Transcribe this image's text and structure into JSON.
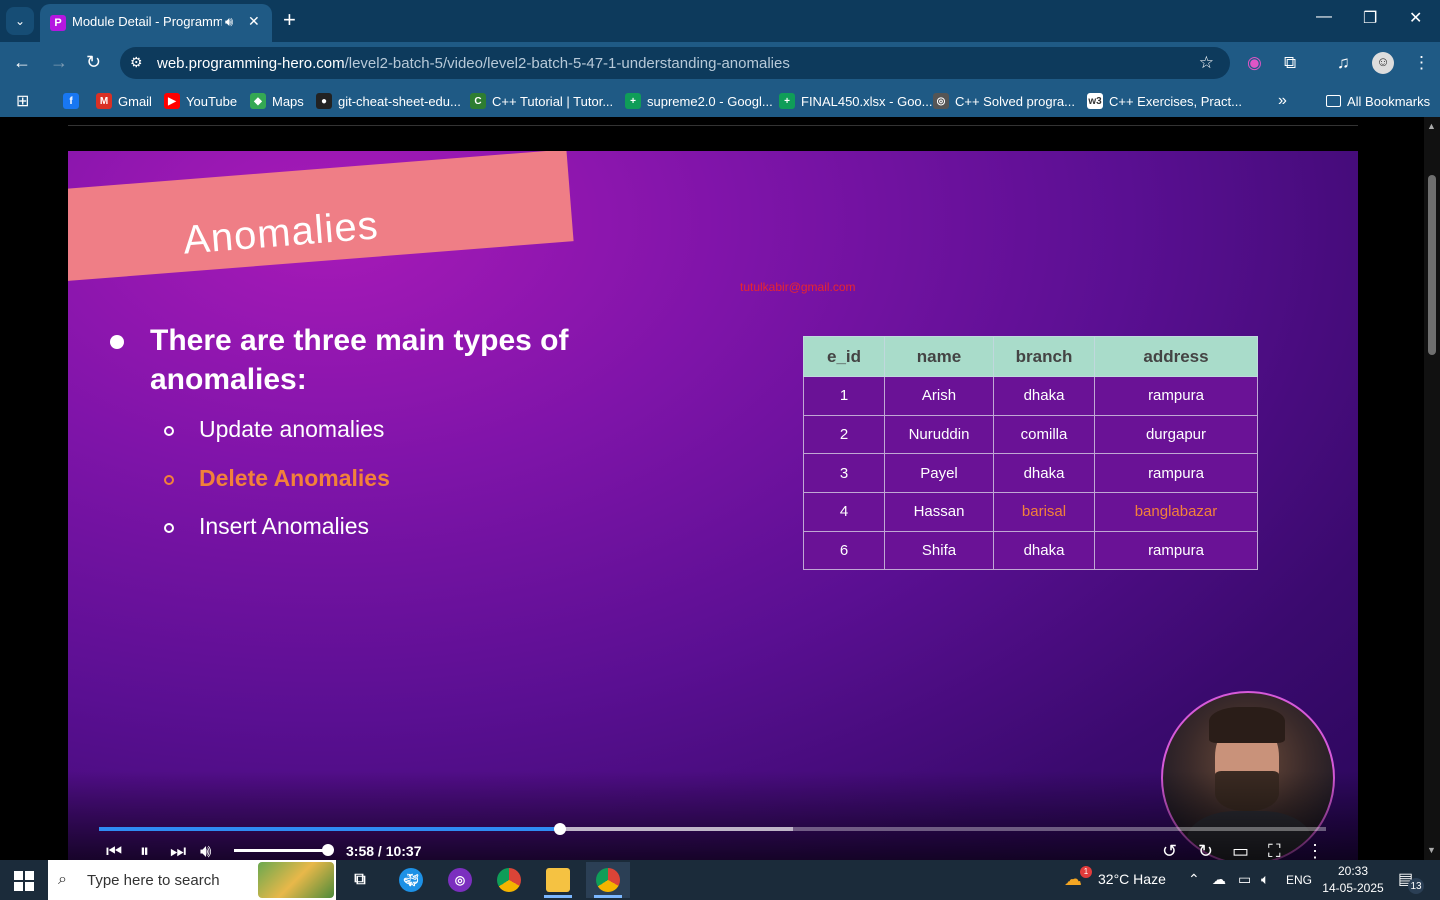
{
  "browser": {
    "tab": {
      "title": "Module Detail - Programmi",
      "favicon": "P"
    },
    "window_controls": [
      "—",
      "❐",
      "✕"
    ],
    "url_domain": "web.programming-hero.com",
    "url_path": "/level2-batch-5/video/level2-batch-5-47-1-understanding-anomalies",
    "bookmarks": [
      {
        "label": "",
        "icon": "f",
        "color": "#1877f2"
      },
      {
        "label": "Gmail",
        "icon": "M",
        "color": "#d93025"
      },
      {
        "label": "YouTube",
        "icon": "▶",
        "color": "#ff0000"
      },
      {
        "label": "Maps",
        "icon": "◆",
        "color": "#34a853"
      },
      {
        "label": "git-cheat-sheet-edu...",
        "icon": "●",
        "color": "#222222"
      },
      {
        "label": "C++ Tutorial | Tutor...",
        "icon": "C",
        "color": "#2e7d32"
      },
      {
        "label": "supreme2.0 - Googl...",
        "icon": "+",
        "color": "#0f9d58"
      },
      {
        "label": "FINAL450.xlsx - Goo...",
        "icon": "+",
        "color": "#0f9d58"
      },
      {
        "label": "C++ Solved progra...",
        "icon": "◎",
        "color": "#555555"
      },
      {
        "label": "C++ Exercises, Pract...",
        "icon": "w3",
        "color": "#ffffff"
      }
    ],
    "all_bookmarks": "All Bookmarks"
  },
  "slide": {
    "title": "Anomalies",
    "email": "tutulkabir@gmail.com",
    "heading": "There are three main types of anomalies:",
    "items": [
      {
        "label": "Update anomalies",
        "highlight": false
      },
      {
        "label": "Delete Anomalies",
        "highlight": true
      },
      {
        "label": "Insert Anomalies",
        "highlight": false
      }
    ],
    "table": {
      "headers": [
        "e_id",
        "name",
        "branch",
        "address"
      ],
      "rows": [
        [
          "1",
          "Arish",
          "dhaka",
          "rampura"
        ],
        [
          "2",
          "Nuruddin",
          "comilla",
          "durgapur"
        ],
        [
          "3",
          "Payel",
          "dhaka",
          "rampura"
        ],
        [
          "4",
          "Hassan",
          "barisal",
          "banglabazar"
        ],
        [
          "6",
          "Shifa",
          "dhaka",
          "rampura"
        ]
      ],
      "highlight_row": 3,
      "highlight_cols": [
        2,
        3
      ],
      "highlight_color": "#f2813a"
    }
  },
  "player": {
    "time": "3:58 / 10:37",
    "played_fraction": 0.376,
    "buffered_fraction": 0.566,
    "volume_fraction": 1.0,
    "accent": "#2f8cf3"
  },
  "taskbar": {
    "search_placeholder": "Type here to search",
    "weather": "32°C  Haze",
    "weather_badge": "1",
    "language": "ENG",
    "time": "20:33",
    "date": "14-05-2025",
    "notifications": "13"
  }
}
